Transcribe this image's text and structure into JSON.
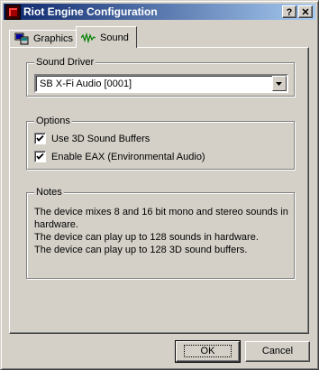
{
  "window": {
    "title": "Riot Engine Configuration",
    "help_glyph": "?",
    "close_glyph": "✕"
  },
  "tabs": [
    {
      "label": "Graphics",
      "icon": "graphics-icon",
      "selected": false
    },
    {
      "label": "Sound",
      "icon": "sound-wave-icon",
      "selected": true
    }
  ],
  "sound_driver": {
    "legend": "Sound Driver",
    "selected_value": "SB X-Fi Audio [0001]"
  },
  "options": {
    "legend": "Options",
    "items": [
      {
        "label": "Use 3D Sound Buffers",
        "checked": true
      },
      {
        "label": "Enable EAX (Environmental Audio)",
        "checked": true
      }
    ]
  },
  "notes": {
    "legend": "Notes",
    "lines": [
      "The device mixes 8 and 16 bit mono and stereo sounds in",
      "hardware.",
      "The device can play up to 128 sounds in hardware.",
      "The device can play up to 128 3D sound buffers."
    ]
  },
  "buttons": {
    "ok": "OK",
    "cancel": "Cancel"
  },
  "colors": {
    "title_start": "#0a246a",
    "title_end": "#a6caf0",
    "face": "#d4d0c8"
  }
}
